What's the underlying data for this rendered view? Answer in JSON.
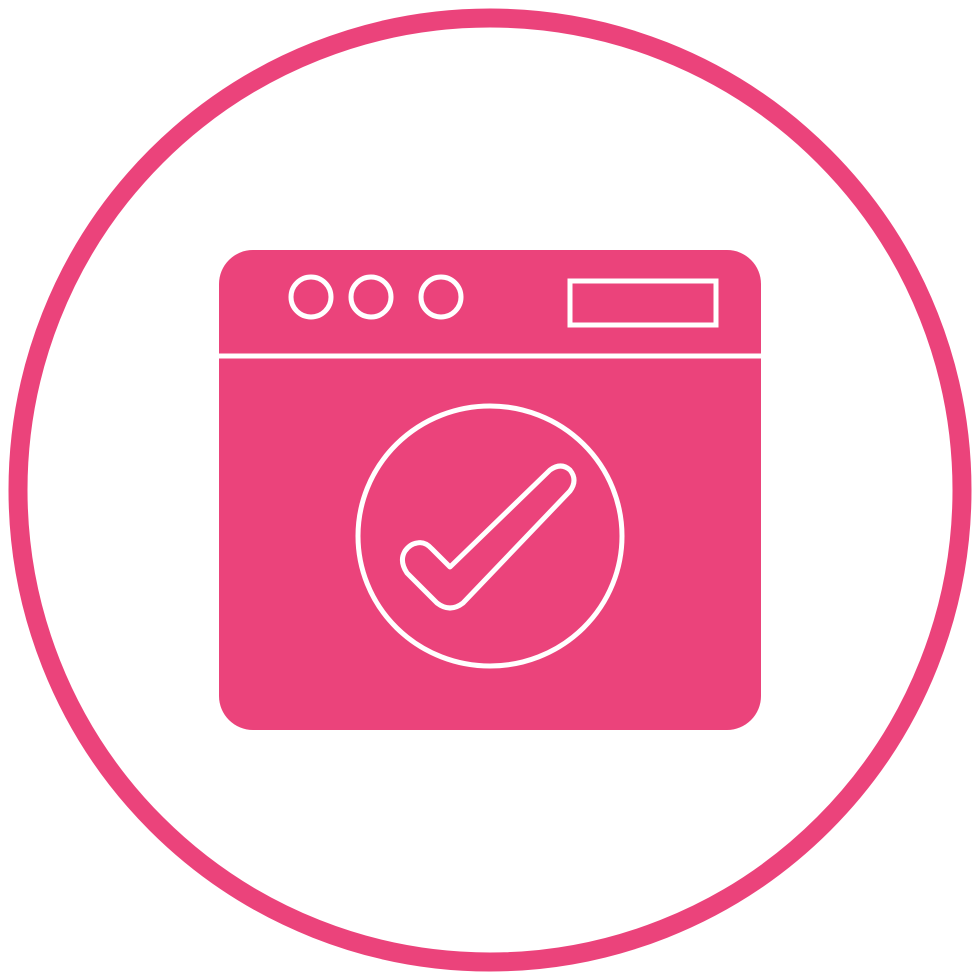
{
  "icon": {
    "name": "browser-window-check-icon",
    "colors": {
      "accent": "#EB437B",
      "background": "#FFFFFF",
      "inner_stroke": "#FFFFFF"
    },
    "window_control_dots": 3
  }
}
